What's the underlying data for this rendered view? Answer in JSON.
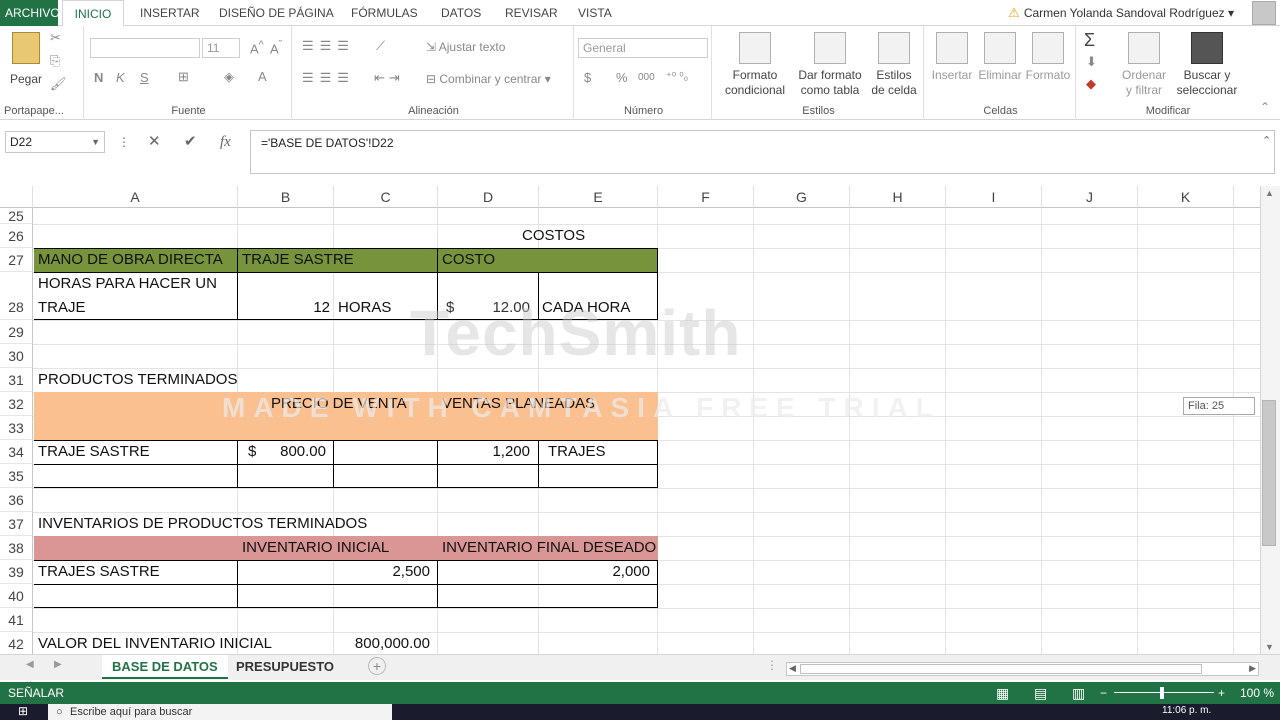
{
  "tabs": {
    "file": "ARCHIVO",
    "items": [
      "INICIO",
      "INSERTAR",
      "DISEÑO DE PÁGINA",
      "FÓRMULAS",
      "DATOS",
      "REVISAR",
      "VISTA"
    ],
    "active": "INICIO"
  },
  "user": {
    "name": "Carmen Yolanda Sandoval Rodríguez"
  },
  "ribbon": {
    "clipboard": {
      "paste": "Pegar",
      "label": "Portapape..."
    },
    "font": {
      "size": "11",
      "bold": "N",
      "italic": "K",
      "underline": "S",
      "label": "Fuente"
    },
    "alignment": {
      "wrap": "Ajustar texto",
      "merge": "Combinar y centrar",
      "label": "Alineación"
    },
    "number": {
      "format": "General",
      "currency": "$",
      "percent": "%",
      "thousands": "000",
      "label": "Número"
    },
    "styles": {
      "cond": "Formato condicional",
      "table": "Dar formato como tabla",
      "cell": "Estilos de celda",
      "label": "Estilos"
    },
    "cells": {
      "insert": "Insertar",
      "delete": "Eliminar",
      "format": "Formato",
      "label": "Celdas"
    },
    "editing": {
      "sort": "Ordenar y filtrar",
      "find": "Buscar y seleccionar",
      "label": "Modificar"
    }
  },
  "formula_bar": {
    "name_box": "D22",
    "formula": "='BASE DE DATOS'!D22",
    "fx": "fx"
  },
  "columns": [
    "A",
    "B",
    "C",
    "D",
    "E",
    "F",
    "G",
    "H",
    "I",
    "J",
    "K"
  ],
  "rows": [
    "25",
    "26",
    "27",
    "28",
    "29",
    "30",
    "31",
    "32",
    "33",
    "34",
    "35",
    "36",
    "37",
    "38",
    "39",
    "40",
    "41",
    "42"
  ],
  "cells": {
    "costos": "COSTOS",
    "mano_obra": "MANO DE OBRA DIRECTA",
    "traje_sastre_hdr": "TRAJE SASTRE",
    "costo": "COSTO",
    "horas_line1": "HORAS PARA HACER UN",
    "horas_line2": "TRAJE",
    "horas_val": "12",
    "horas_unit": "HORAS",
    "dollar1": "$",
    "costo_val": "12.00",
    "cada_hora": "CADA HORA",
    "productos": "PRODUCTOS TERMINADOS",
    "precio_venta": "PRECIO DE VENTA",
    "ventas_plan": "VENTAS PLANEADAS",
    "traje_sastre": "TRAJE SASTRE",
    "dollar2": "$",
    "precio_val": "800.00",
    "ventas_val": "1,200",
    "trajes": "TRAJES",
    "inventarios": "INVENTARIOS DE PRODUCTOS TERMINADOS",
    "inv_inicial": "INVENTARIO INICIAL",
    "inv_final": "INVENTARIO FINAL DESEADO",
    "trajes_sastre": "TRAJES SASTRE",
    "inv_ini_val": "2,500",
    "inv_fin_val": "2,000",
    "valor_inv": "VALOR DEL INVENTARIO INICIAL",
    "valor_inv_val": "800,000.00"
  },
  "watermark": {
    "brand": "TechSmith",
    "trial": "MADE WITH CAMTASIA FREE TRIAL"
  },
  "scroll_tooltip": "Fila: 25",
  "sheets": [
    "BASE DE DATOS",
    "PRESUPUESTO"
  ],
  "active_sheet": "BASE DE DATOS",
  "status": {
    "mode": "SEÑALAR",
    "zoom": "100 %"
  },
  "taskbar": {
    "search": "Escribe aquí para buscar",
    "time": "11:06 p. m."
  },
  "colors": {
    "excel_green": "#217346",
    "header_green": "#77933c",
    "orange": "#fac090",
    "pink": "#da9694"
  }
}
